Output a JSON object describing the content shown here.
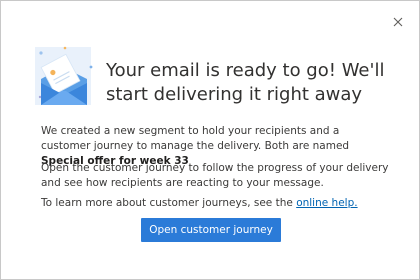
{
  "dialog": {
    "headline": "Your email is ready to go! We'll start delivering it right away",
    "paragraph1": {
      "text": "We created a new segment to hold your recipients and a customer journey to manage the delivery. Both are named ",
      "emphasis": "Special offer for week 33"
    },
    "paragraph2": "Open the customer journey to follow the progress of your delivery and see how recipients are reacting to your message.",
    "paragraph3": {
      "text": "To learn more about customer journeys, see the ",
      "link": "online help."
    },
    "primary_button": "Open customer journey",
    "icons": {
      "close": "close-icon",
      "illustration": "envelope-letter-illustration"
    },
    "colors": {
      "accent": "#2b7bd8",
      "link": "#0063b1"
    }
  }
}
